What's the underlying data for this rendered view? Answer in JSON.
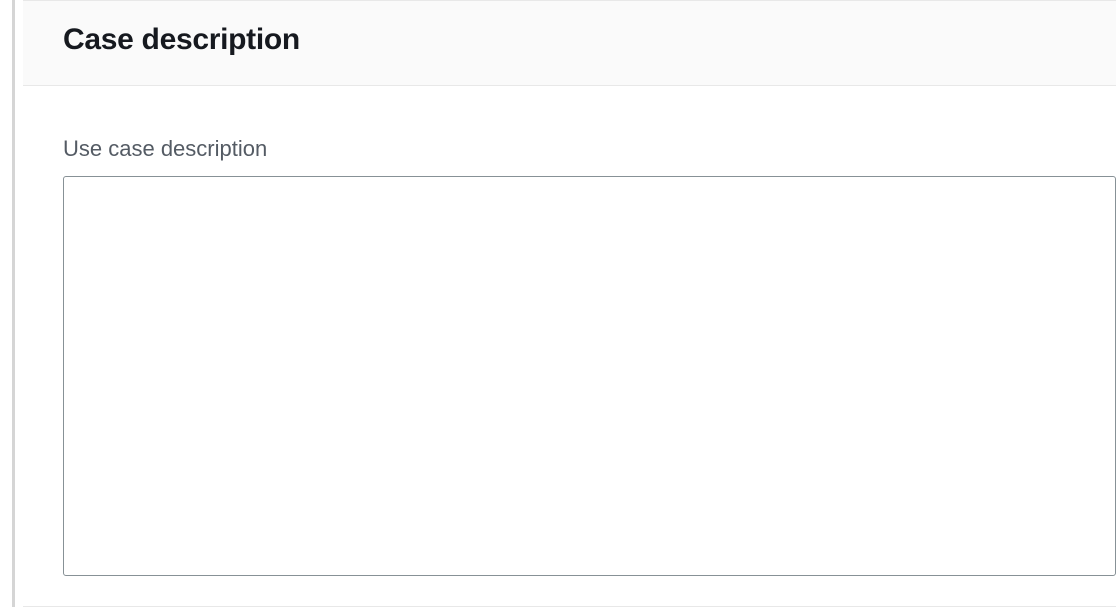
{
  "panel": {
    "title": "Case description"
  },
  "form": {
    "use_case_label": "Use case description",
    "use_case_value": ""
  }
}
